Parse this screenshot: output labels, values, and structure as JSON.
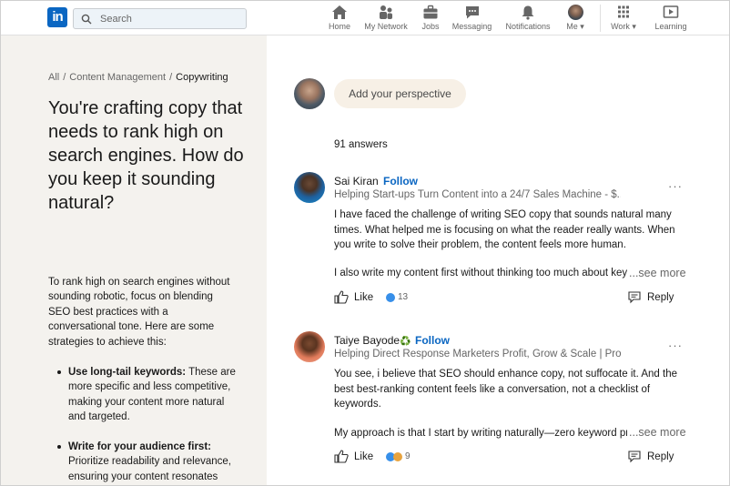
{
  "nav": {
    "logo": "in",
    "search_placeholder": "Search",
    "items": [
      {
        "label": "Home",
        "icon": "home-icon"
      },
      {
        "label": "My Network",
        "icon": "network-icon"
      },
      {
        "label": "Jobs",
        "icon": "briefcase-icon"
      },
      {
        "label": "Messaging",
        "icon": "chat-icon"
      },
      {
        "label": "Notifications",
        "icon": "bell-icon"
      },
      {
        "label": "Me",
        "icon": "avatar-icon"
      },
      {
        "label": "Work",
        "icon": "grid-icon"
      },
      {
        "label": "Learning",
        "icon": "learning-icon"
      }
    ]
  },
  "breadcrumb": {
    "items": [
      "All",
      "Content Management",
      "Copywriting"
    ]
  },
  "question": {
    "title": "You're crafting copy that needs to rank high on search engines. How do you keep it sounding natural?",
    "intro": "To rank high on search engines without sounding robotic, focus on blending SEO best practices with a conversational tone. Here are some strategies to achieve this:",
    "bullets": [
      {
        "bold": "Use long-tail keywords:",
        "text": " These are more specific and less competitive, making your content more natural and targeted."
      },
      {
        "bold": "Write for your audience first:",
        "text": " Prioritize readability and relevance, ensuring your content resonates"
      }
    ]
  },
  "composer": {
    "button": "Add your perspective"
  },
  "answers_count": "91 answers",
  "answers": [
    {
      "name": "Sai Kiran",
      "follow": "Follow",
      "headline": "Helping Start-ups Turn Content into a 24/7 Sales Machine - $...",
      "body": "I have faced the challenge of writing SEO copy that sounds natural many times. What helped me is focusing on what the reader really wants. When you write to solve their problem, the content feels more human.",
      "last_line": "I also write my content first without thinking too much about key",
      "see_more": "...see more",
      "like": "Like",
      "reactions": "13",
      "reply": "Reply"
    },
    {
      "name": "Taiye Bayode",
      "badge": "♻️",
      "follow": "Follow",
      "headline": "Helping Direct Response Marketers Profit, Grow & Scale | Pro...",
      "body": "You see, i believe that SEO should enhance copy, not suffocate it. And the best best-ranking content feels like a conversation, not a checklist of keywords.",
      "last_line": "My approach is that I start by writing naturally—zero keyword pre",
      "see_more": "...see more",
      "like": "Like",
      "reactions": "9",
      "reply": "Reply"
    }
  ],
  "colors": {
    "brand": "#0a66c2",
    "left_bg": "#f4f2ee",
    "composer_bg": "#f7f0e6"
  }
}
